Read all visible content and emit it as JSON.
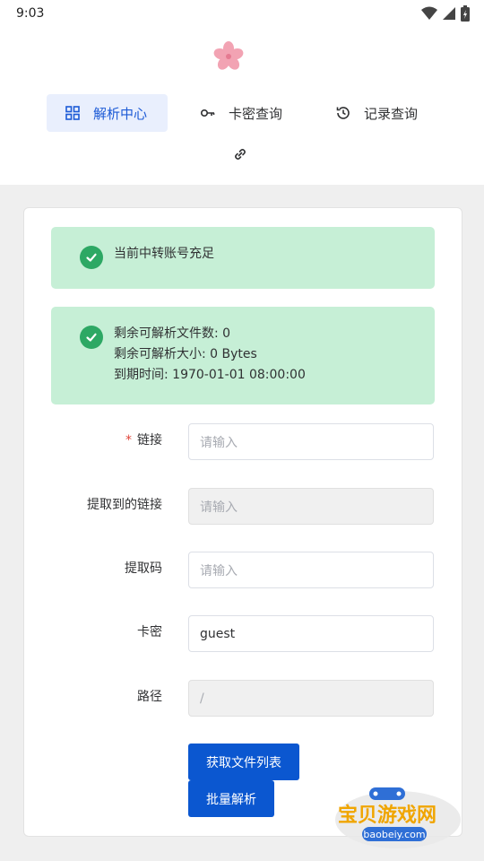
{
  "statusbar": {
    "time": "9:03"
  },
  "nav": {
    "items": [
      {
        "label": "解析中心",
        "icon": "grid-icon",
        "active": true
      },
      {
        "label": "卡密查询",
        "icon": "key-icon",
        "active": false
      },
      {
        "label": "记录查询",
        "icon": "history-icon",
        "active": false
      }
    ],
    "link_icon": "link-icon"
  },
  "alerts": {
    "status": "当前中转账号充足",
    "info": [
      "剩余可解析文件数: 0",
      "剩余可解析大小: 0 Bytes",
      "到期时间: 1970-01-01 08:00:00"
    ]
  },
  "form": {
    "link": {
      "label": "链接",
      "placeholder": "请输入",
      "required": true
    },
    "extracted_link": {
      "label": "提取到的链接",
      "placeholder": "请输入"
    },
    "extract_code": {
      "label": "提取码",
      "placeholder": "请输入"
    },
    "card_key": {
      "label": "卡密",
      "value": "guest"
    },
    "path": {
      "label": "路径",
      "value": "/"
    }
  },
  "buttons": {
    "get_list": "获取文件列表",
    "batch_parse": "批量解析"
  },
  "watermark": {
    "title": "宝贝游戏网",
    "url": "baobeiy.com"
  },
  "colors": {
    "primary": "#0b57d0",
    "success_bg": "#c6efd6",
    "success_icon": "#2da864",
    "required": "#e0453a"
  }
}
